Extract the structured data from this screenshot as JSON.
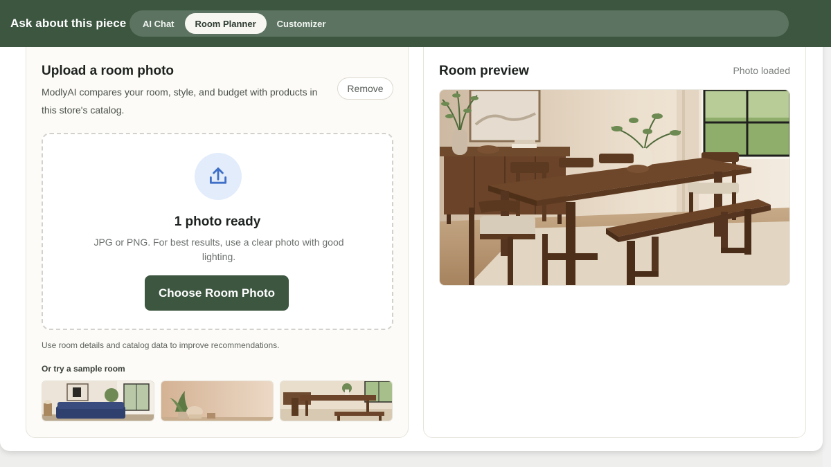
{
  "header": {
    "title": "Ask about this piece",
    "tabs": [
      {
        "label": "AI Chat",
        "active": false
      },
      {
        "label": "Room Planner",
        "active": true
      },
      {
        "label": "Customizer",
        "active": false
      }
    ],
    "colors": {
      "bar": "#3c5640",
      "pill": "#5b7360",
      "active_tab": "#f7f6f1"
    }
  },
  "upload": {
    "title": "Upload a room photo",
    "description": "ModlyAI compares your room, style, and budget with products in this store's catalog.",
    "remove_label": "Remove",
    "dropzone": {
      "icon": "upload-icon",
      "status": "1 photo ready",
      "hint": "JPG or PNG. For best results, use a clear photo with good lighting.",
      "button_label": "Choose Room Photo"
    },
    "data_note": "Use room details and catalog data to improve recommendations.",
    "samples_label": "Or try a sample room",
    "samples": [
      {
        "image": "living-room-blue-sofa"
      },
      {
        "image": "beige-room-chair-plant"
      },
      {
        "image": "dining-room-table-bench"
      }
    ]
  },
  "preview": {
    "title": "Room preview",
    "status": "Photo loaded",
    "image": "dining-room-walnut-table"
  }
}
